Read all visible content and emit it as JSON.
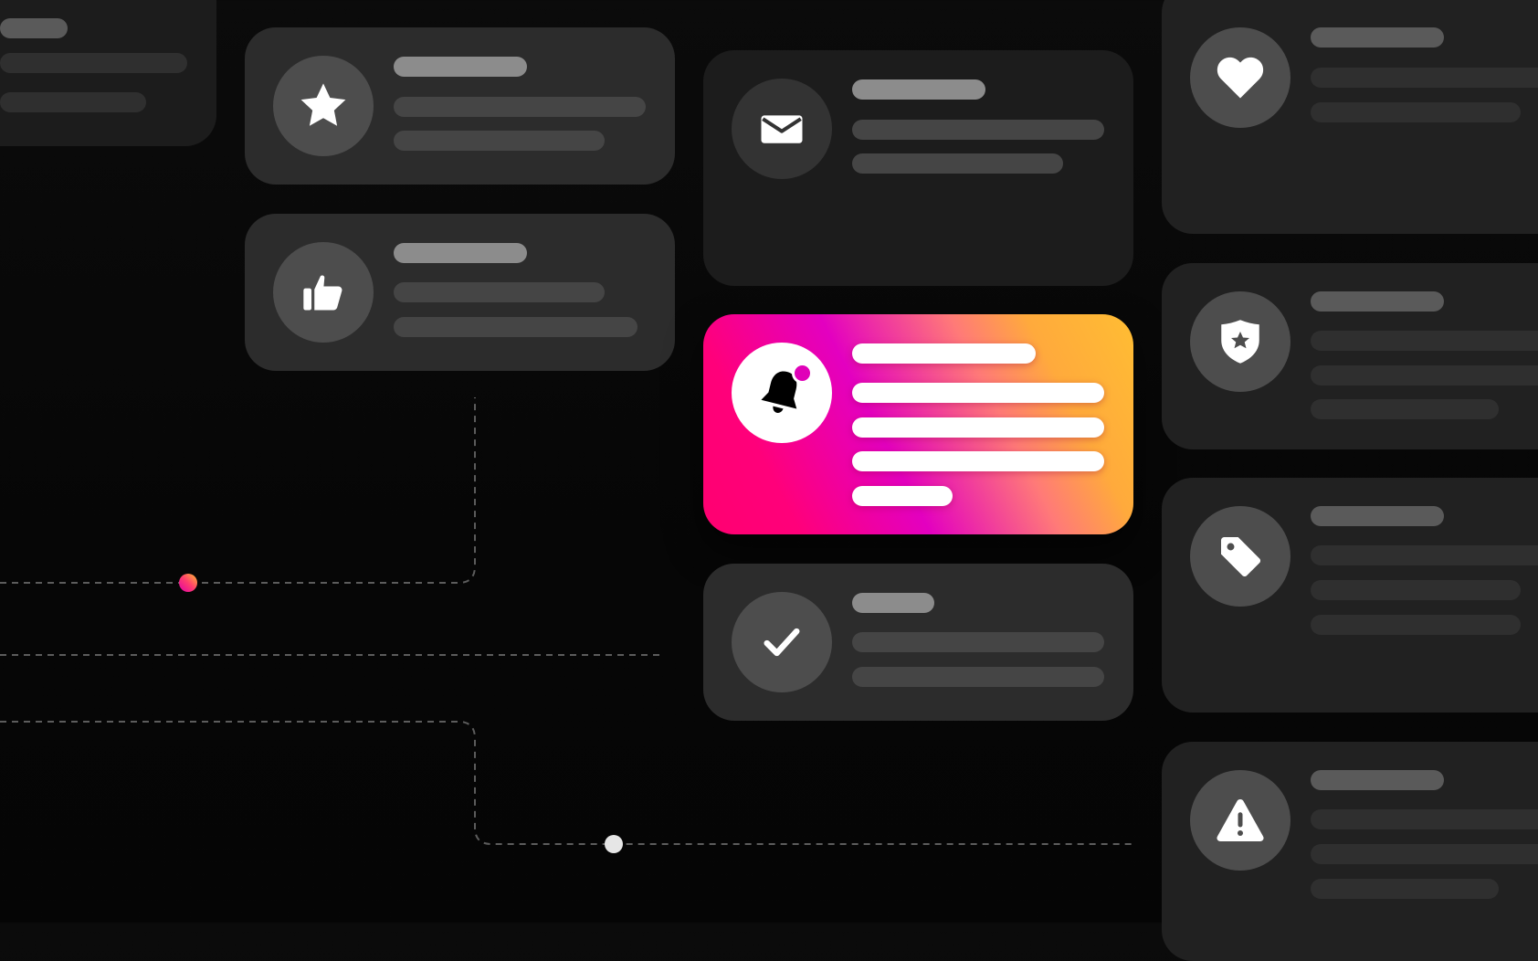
{
  "canvas": {
    "background": "#070707",
    "accent_gradient": [
      "#ff0070",
      "#e000c4",
      "#ff8a6a",
      "#ffbd33"
    ]
  },
  "cards": [
    {
      "id": "partial-top-left",
      "icon": null,
      "style": "dark",
      "highlighted": false,
      "placeholder_lines": 3
    },
    {
      "id": "star",
      "icon": "star-icon",
      "style": "mid",
      "highlighted": false,
      "placeholder_lines": 3
    },
    {
      "id": "thumbs-up",
      "icon": "thumbs-up-icon",
      "style": "mid",
      "highlighted": false,
      "placeholder_lines": 3
    },
    {
      "id": "mail",
      "icon": "mail-icon",
      "style": "dark",
      "highlighted": false,
      "placeholder_lines": 3
    },
    {
      "id": "notification",
      "icon": "bell-icon",
      "style": "gradient",
      "highlighted": true,
      "badge": true,
      "placeholder_lines": 5
    },
    {
      "id": "check",
      "icon": "check-icon",
      "style": "mid",
      "highlighted": false,
      "placeholder_lines": 3
    },
    {
      "id": "heart",
      "icon": "heart-icon",
      "style": "right",
      "highlighted": false,
      "placeholder_lines": 3
    },
    {
      "id": "shield",
      "icon": "shield-star-icon",
      "style": "right",
      "highlighted": false,
      "placeholder_lines": 4
    },
    {
      "id": "tag",
      "icon": "tag-icon",
      "style": "right",
      "highlighted": false,
      "placeholder_lines": 4
    },
    {
      "id": "warning",
      "icon": "warning-icon",
      "style": "right",
      "highlighted": false,
      "placeholder_lines": 4
    }
  ],
  "connectors": {
    "style": "dashed",
    "color": "#5c5c5c",
    "nodes": [
      {
        "name": "gradient-node",
        "color": "#ff3d7f"
      },
      {
        "name": "white-node",
        "color": "#e6e6e6"
      }
    ]
  }
}
